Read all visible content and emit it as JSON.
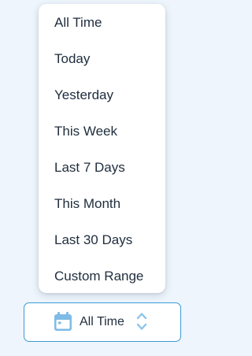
{
  "menu": {
    "items": [
      {
        "label": "All Time"
      },
      {
        "label": "Today"
      },
      {
        "label": "Yesterday"
      },
      {
        "label": "This Week"
      },
      {
        "label": "Last 7 Days"
      },
      {
        "label": "This Month"
      },
      {
        "label": "Last 30 Days"
      },
      {
        "label": "Custom Range"
      }
    ]
  },
  "selector": {
    "selected_label": "All Time",
    "icon": "calendar-icon",
    "toggle_icon": "chevron-up-down-icon"
  },
  "colors": {
    "background": "#eef5fc",
    "accent": "#3a9ad6",
    "icon": "#7fbbe6",
    "text": "#1f2d3d"
  }
}
